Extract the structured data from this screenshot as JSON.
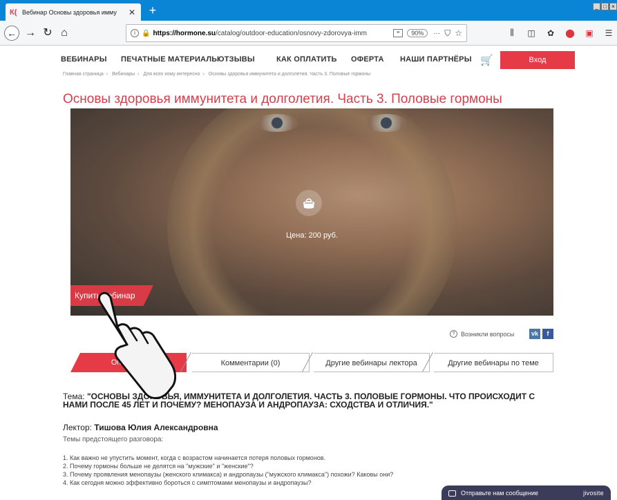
{
  "browser": {
    "tab_title": "Вебинар Основы здоровья имму",
    "tab_favicon": "К(",
    "tab_close": "✕",
    "new_tab": "+",
    "url_host": "https://hormone.su",
    "url_path": "/catalog/outdoor-education/osnovy-zdorovya-imm",
    "zoom": "90%",
    "more": "···",
    "window_controls": [
      "_",
      "□",
      "×"
    ],
    "icons": [
      "back-arrow-icon",
      "forward-arrow-icon",
      "reload-icon",
      "home-icon",
      "info-icon",
      "lock-icon",
      "reader-icon",
      "pocket-icon",
      "star-icon",
      "library-icon",
      "sidebar-icon",
      "extension-icon",
      "adblock-icon",
      "menu-icon"
    ]
  },
  "site": {
    "nav": [
      "ВЕБИНАРЫ",
      "ПЕЧАТНЫЕ МАТЕРИАЛЫ",
      "ОТЗЫВЫ",
      "КАК ОПЛАТИТЬ",
      "ОФЕРТА",
      "НАШИ ПАРТНЁРЫ"
    ],
    "login": "Вход",
    "breadcrumbs": [
      "Главная страница",
      "Вебинары",
      "Для всех кому интересно",
      "Основы здоровья иммунитета и долголетия. Часть 3. Половые гормоны"
    ],
    "title": "Основы здоровья иммунитета и долголетия. Часть 3. Половые гормоны",
    "price": "Цена: 200 руб.",
    "buy": "Купить вебинар",
    "questions": "Возникли вопросы",
    "social": [
      "vk",
      "f"
    ],
    "tabs": [
      "Описание",
      "Комментарии (0)",
      "Другие вебинары лектора",
      "Другие вебинары по теме"
    ],
    "topic_label": "Тема:",
    "topic_text": "\"ОСНОВЫ ЗДОРОВЬЯ, ИММУНИТЕТА И ДОЛГОЛЕТИЯ. ЧАСТЬ 3. ПОЛОВЫЕ ГОРМОНЫ. ЧТО ПРОИСХОДИТ С НАМИ ПОСЛЕ 45 ЛЕТ И ПОЧЕМУ? МЕНОПАУЗА И АНДРОПАУЗА: СХОДСТВА И ОТЛИЧИЯ.\"",
    "lecturer_label": "Лектор:",
    "lecturer_name": "Тишова Юлия Александровна",
    "subtitle": "Темы предстоящего разговора:",
    "questions_list": [
      "1. Как важно не упустить момент, когда с возрастом начинается потеря половых гормонов.",
      "2. Почему гормоны больше не делятся на \"мужские\" и \"женские\"?",
      "3. Почему проявления менопаузы (женского климакса) и андропаузы (\"мужского климакса\") похожи? Каковы они?",
      "4. Как сегодня можно эффективно бороться с симптомами менопаузы и андропаузы?"
    ],
    "chat_label": "Отправьте нам сообщение",
    "chat_brand": "jivosite"
  },
  "colors": {
    "accent": "#e63a47",
    "title": "#d2404c",
    "browser_tabbar": "#0a84d4",
    "chat": "#3b3c5a"
  }
}
